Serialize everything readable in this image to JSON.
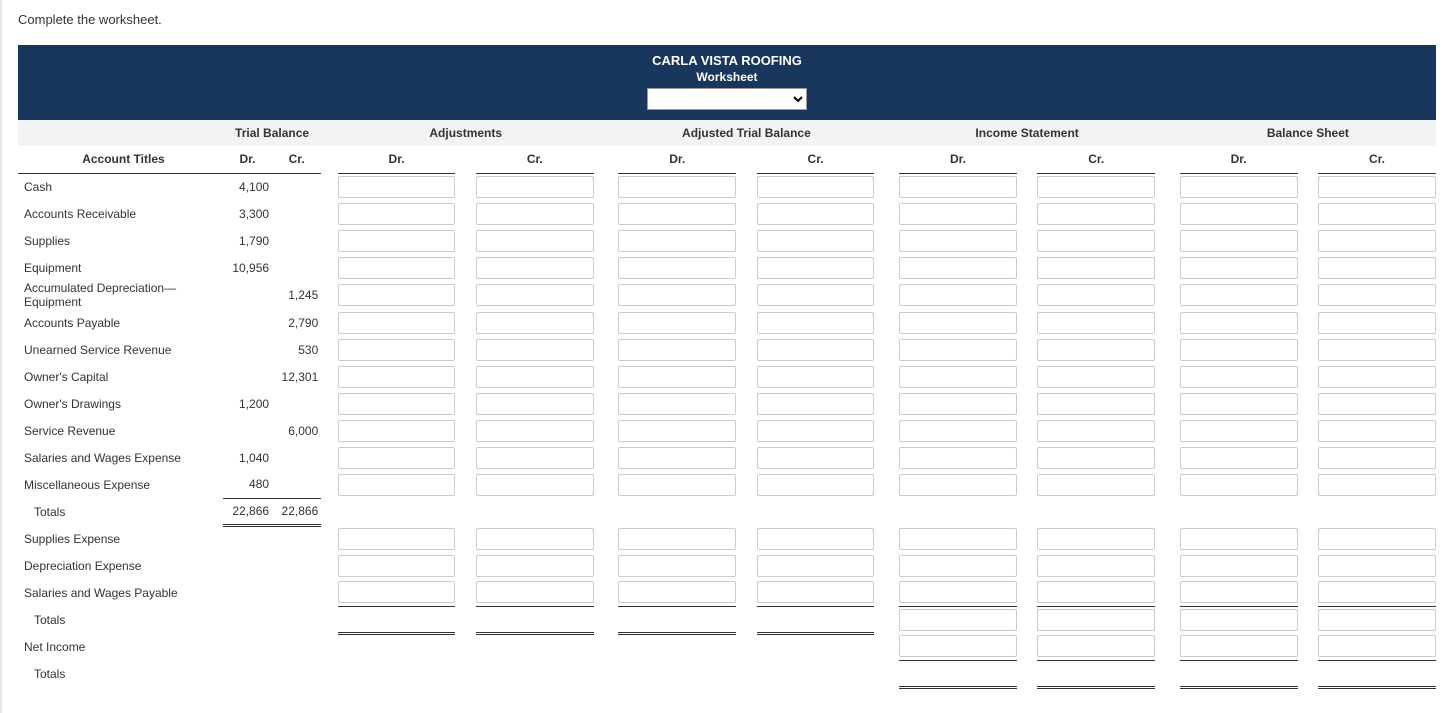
{
  "instruction": "Complete the worksheet.",
  "banner": {
    "company": "CARLA VISTA ROOFING",
    "subtitle": "Worksheet",
    "select_value": ""
  },
  "headers": {
    "account_titles": "Account Titles",
    "trial_balance": "Trial Balance",
    "adjustments": "Adjustments",
    "adjusted_tb": "Adjusted Trial Balance",
    "income_stmt": "Income Statement",
    "balance_sheet": "Balance Sheet",
    "dr": "Dr.",
    "cr": "Cr."
  },
  "rows": [
    {
      "title": "Cash",
      "tb_dr": "4,100",
      "tb_cr": "",
      "inputs": true
    },
    {
      "title": "Accounts Receivable",
      "tb_dr": "3,300",
      "tb_cr": "",
      "inputs": true
    },
    {
      "title": "Supplies",
      "tb_dr": "1,790",
      "tb_cr": "",
      "inputs": true
    },
    {
      "title": "Equipment",
      "tb_dr": "10,956",
      "tb_cr": "",
      "inputs": true
    },
    {
      "title": "Accumulated Depreciation—Equipment",
      "tb_dr": "",
      "tb_cr": "1,245",
      "inputs": true
    },
    {
      "title": "Accounts Payable",
      "tb_dr": "",
      "tb_cr": "2,790",
      "inputs": true
    },
    {
      "title": "Unearned Service Revenue",
      "tb_dr": "",
      "tb_cr": "530",
      "inputs": true
    },
    {
      "title": "Owner's Capital",
      "tb_dr": "",
      "tb_cr": "12,301",
      "inputs": true
    },
    {
      "title": "Owner's Drawings",
      "tb_dr": "1,200",
      "tb_cr": "",
      "inputs": true
    },
    {
      "title": "Service Revenue",
      "tb_dr": "",
      "tb_cr": "6,000",
      "inputs": true
    },
    {
      "title": "Salaries and Wages Expense",
      "tb_dr": "1,040",
      "tb_cr": "",
      "inputs": true
    },
    {
      "title": "Miscellaneous Expense",
      "tb_dr": "480",
      "tb_cr": "",
      "inputs": true
    }
  ],
  "totals1": {
    "title": "Totals",
    "dr": "22,866",
    "cr": "22,866"
  },
  "extra_rows": [
    {
      "title": "Supplies Expense"
    },
    {
      "title": "Depreciation Expense"
    },
    {
      "title": "Salaries and Wages Payable"
    }
  ],
  "totals2": {
    "title": "Totals"
  },
  "net_income": {
    "title": "Net Income"
  },
  "totals3": {
    "title": "Totals"
  }
}
